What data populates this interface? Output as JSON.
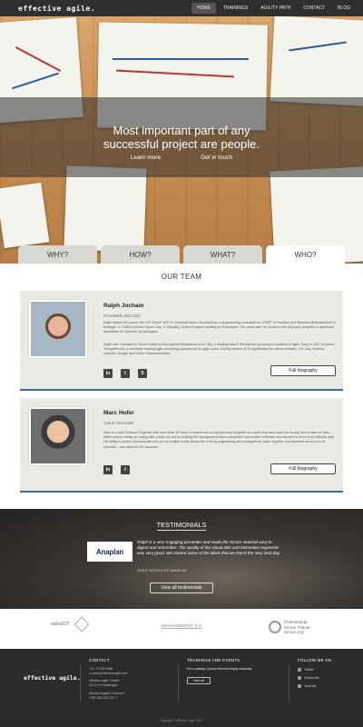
{
  "header": {
    "logo": "effective agile.",
    "nav": [
      "HOME",
      "TRAININGS",
      "AGILITY PATH",
      "CONTACT",
      "BLOG"
    ],
    "active_nav": "HOME"
  },
  "hero": {
    "title_line1": "Most important part of any",
    "title_line2": "successful project are people.",
    "btn_learn": "Learn more",
    "btn_touch": "Get in touch"
  },
  "tabs": [
    "WHY?",
    "HOW?",
    "WHAT?",
    "WHO?"
  ],
  "team": {
    "title": "OUR TEAM",
    "members": [
      {
        "name": "Ralph Jocham",
        "role": "FOUNDER AND CEO",
        "bio1": "Ralph started his career with ISO GmbH 1997 in Germany where he worked as a programming consultant for START in Frankfurt and Siemens Medizintechnik in Erlangen. In 1998 he joined Oracle Corp. in Reading, United Kingdom working on JDeveloper. Two years later he moved to the USA and consulted in downtown Manhattan for Spherion Technologies.",
        "bio2": "Ralph later relocated to Silicon Valley to help Applied Biosystems (now Life), a leading biotech life science company to transition to Agile. Early in 2007 he joined ThoughtWorks, a worldwide leading agile consulting company as an agile coach. During his time at ThoughtWorks his clients included, The Gap, Invenso, LinkedIn, Google and Roche Pharmaceuticals.",
        "button": "Full biography"
      },
      {
        "name": "Marc Hofer",
        "role": "AGILE TEACHER",
        "bio1": "Marc is a solid Software Engineer with more than 15 Years of experience on big and small projects. As a tech lead and coach he usually tries to take on roles which involve hands-on coding with a team as well as helping the management team understand how modern software development is done in an effective way. His ability to clearly communicate and act on multiple levels allows him to bring engineering and management closer together and therefore unlock a lot of potential – and value for the customer.",
        "button": "Full biography"
      }
    ]
  },
  "testimonials": {
    "title": "TESTIMONIALS",
    "company": "Anaplan",
    "quote": "Ralph is a very engaging presenter and made the Scrum material easy to digest and remember. The quality of the visual aids and interactive segments was very good. We started some of the ideas that we learnt the very next day.",
    "author": "GREG REYNOLDS",
    "author_company": "ANAPLAN",
    "button": "View all testimonials"
  },
  "partners": {
    "p1": "swissICT",
    "p2": "MANAGEMENT 3.0",
    "p3_line1": "Professional",
    "p3_line2": "Scrum Trainer",
    "p3_line3": "Scrum.org"
  },
  "footer": {
    "logo": "effective agile.",
    "contact_h": "CONTACT",
    "phone": "+41 79 448 6388",
    "email": "contact@effectiveagile.com",
    "addr1": "effective agile. GmbH",
    "addr2": "CH-3110 Münsingen",
    "reg1": "Handelsregister Nummer",
    "reg2": "CHE-264.490.222-7",
    "trainings_h": "TRAININGS AND EVENTS",
    "trainings_err": "Error parsing: Query returned empty response",
    "view_all": "View all",
    "follow_h": "FOLLOW ME ON",
    "social": [
      "Twitter",
      "Subscribe",
      "Youtube"
    ],
    "copyright": "Copyright © effective agile 2017."
  }
}
